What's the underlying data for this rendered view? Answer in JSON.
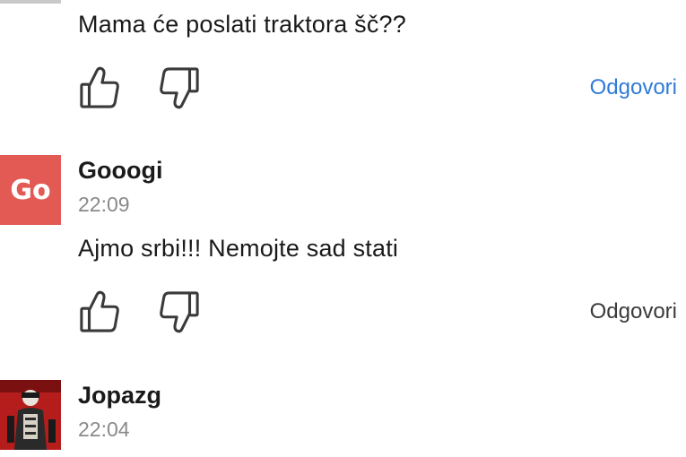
{
  "comments": [
    {
      "text": "Mama će poslati traktora šč??",
      "actions": {
        "reply_label": "Odgovori"
      }
    },
    {
      "author": "Gooogi",
      "avatar_initials": "Go",
      "avatar_color": "#e35a55",
      "time": "22:09",
      "text": "Ajmo srbi!!! Nemojte sad stati",
      "actions": {
        "reply_label": "Odgovori"
      }
    },
    {
      "author": "Jopazg",
      "time": "22:04"
    }
  ],
  "colors": {
    "reply_link_active": "#2f7bd8",
    "reply_link_default": "#3a3a3a",
    "timestamp": "#8a8a8a"
  },
  "icons": {
    "like": "thumbs-up-outline",
    "dislike": "thumbs-down-outline"
  }
}
